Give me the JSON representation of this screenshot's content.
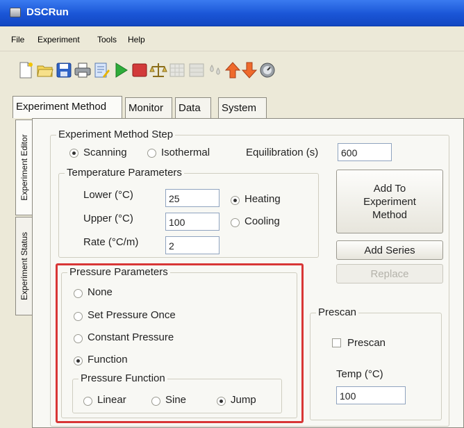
{
  "window": {
    "title": "DSCRun"
  },
  "menu": [
    "File",
    "Experiment",
    "Tools",
    "Help"
  ],
  "toolbar": {
    "icons": [
      "new-icon",
      "open-icon",
      "save-icon",
      "print-icon",
      "edit-icon",
      "run-icon",
      "stop-icon",
      "balance-icon",
      "grid-icon",
      "grid2-icon",
      "drops-icon",
      "arrow-up-icon",
      "arrow-down-icon",
      "gauge-icon"
    ]
  },
  "tabs": [
    "Experiment Method",
    "Monitor",
    "Data",
    "System"
  ],
  "side_tabs": [
    "Experiment Editor",
    "Experiment Status"
  ],
  "method_step": {
    "legend": "Experiment Method Step",
    "scanning": "Scanning",
    "isothermal": "Isothermal",
    "selected": "Scanning",
    "equilibration_label": "Equilibration (s)",
    "equilibration_value": "600"
  },
  "temperature": {
    "legend": "Temperature Parameters",
    "lower_label": "Lower (°C)",
    "lower_value": "25",
    "upper_label": "Upper (°C)",
    "upper_value": "100",
    "rate_label": "Rate (°C/m)",
    "rate_value": "2",
    "heating": "Heating",
    "cooling": "Cooling",
    "selected": "Heating"
  },
  "buttons": {
    "add_to_method": "Add To Experiment Method",
    "add_series": "Add Series",
    "replace": "Replace"
  },
  "pressure": {
    "legend": "Pressure Parameters",
    "none": "None",
    "set_once": "Set Pressure Once",
    "constant": "Constant Pressure",
    "function": "Function",
    "selected": "Function",
    "function_group": {
      "legend": "Pressure Function",
      "linear": "Linear",
      "sine": "Sine",
      "jump": "Jump",
      "selected": "Jump"
    }
  },
  "prescan": {
    "legend": "Prescan",
    "checkbox_label": "Prescan",
    "checked": false,
    "temp_label": "Temp (°C)",
    "temp_value": "100"
  },
  "colors": {
    "highlight": "#d83636",
    "titlebar": "#1a55d6"
  }
}
